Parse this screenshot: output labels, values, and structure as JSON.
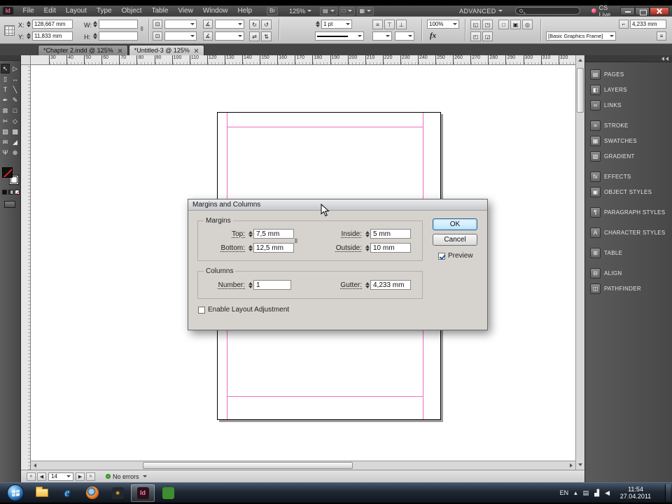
{
  "app_bar": {
    "logo_text": "Id",
    "menus": [
      {
        "name": "menu-file",
        "label": "File"
      },
      {
        "name": "menu-edit",
        "label": "Edit"
      },
      {
        "name": "menu-layout",
        "label": "Layout"
      },
      {
        "name": "menu-type",
        "label": "Type"
      },
      {
        "name": "menu-object",
        "label": "Object"
      },
      {
        "name": "menu-table",
        "label": "Table"
      },
      {
        "name": "menu-view",
        "label": "View"
      },
      {
        "name": "menu-window",
        "label": "Window"
      },
      {
        "name": "menu-help",
        "label": "Help"
      }
    ],
    "bridge_label": "Br",
    "zoom_value": "125%",
    "view_buttons": [
      {
        "name": "view-options-button",
        "glyph": "▤"
      },
      {
        "name": "screen-mode-button",
        "glyph": "□"
      },
      {
        "name": "arrange-documents-button",
        "glyph": "▦"
      }
    ],
    "workspace": "ADVANCED",
    "cs_live_label": "CS Live"
  },
  "control_panel": {
    "x_label": "X:",
    "x_value": "128,667 mm",
    "y_label": "Y:",
    "y_value": "11,833 mm",
    "w_label": "W:",
    "w_value": "",
    "h_label": "H:",
    "h_value": "",
    "chain_glyph": "∞",
    "scale_icon_glyph": "⊡",
    "shear_icon_glyph": "∡",
    "transform_buttons": [
      {
        "name": "rotate-90-cw-button",
        "glyph": "↻"
      },
      {
        "name": "rotate-90-ccw-button",
        "glyph": "↺"
      },
      {
        "name": "flip-horizontal-button",
        "glyph": "⇄"
      },
      {
        "name": "flip-vertical-button",
        "glyph": "⇅"
      }
    ],
    "stroke_weight": "1 pt",
    "stroke_icons": [
      {
        "name": "stroke-align-icon",
        "glyph": "≡"
      },
      {
        "name": "cap-icon",
        "glyph": "⊤"
      },
      {
        "name": "join-icon",
        "glyph": "⊥"
      }
    ],
    "fx_label": "fx",
    "opacity_value": "100%",
    "fitting_buttons": [
      {
        "name": "fill-frame-proportionally-button",
        "glyph": "◱"
      },
      {
        "name": "fit-content-proportionally-button",
        "glyph": "◳"
      },
      {
        "name": "center-content-button",
        "glyph": "◰"
      },
      {
        "name": "fit-frame-to-content-button",
        "glyph": "◲"
      }
    ],
    "wrap_buttons": [
      {
        "name": "no-text-wrap-button",
        "glyph": "□"
      },
      {
        "name": "wrap-around-bounding-box-button",
        "glyph": "▣"
      },
      {
        "name": "wrap-around-object-shape-button",
        "glyph": "◎"
      }
    ],
    "corner_icon_glyph": "⌐",
    "corner_radius": "4,233 mm",
    "object_style": "[Basic Graphics Frame]",
    "panel_menu_glyph": "≡"
  },
  "tabs": [
    {
      "name": "document-tab-chapter2",
      "label": "*Chapter 2.indd @ 125%"
    },
    {
      "name": "document-tab-untitled3",
      "label": "*Untitled-3 @ 125%",
      "active": true
    }
  ],
  "ruler": {
    "numbers": [
      30,
      40,
      50,
      60,
      70,
      80,
      90,
      100,
      110,
      120,
      130,
      140,
      150,
      160,
      170,
      180,
      190,
      200,
      210,
      220,
      230,
      240,
      250,
      260,
      270,
      280,
      290,
      300,
      310,
      320
    ]
  },
  "tools": [
    {
      "name": "selection-tool",
      "glyph": "↖"
    },
    {
      "name": "direct-selection-tool",
      "glyph": "▷"
    },
    {
      "name": "page-tool",
      "glyph": "▯"
    },
    {
      "name": "gap-tool",
      "glyph": "↔"
    },
    {
      "name": "type-tool",
      "glyph": "T"
    },
    {
      "name": "line-tool",
      "glyph": "╲"
    },
    {
      "name": "pen-tool",
      "glyph": "✒"
    },
    {
      "name": "pencil-tool",
      "glyph": "✎"
    },
    {
      "name": "rectangle-frame-tool",
      "glyph": "⊠"
    },
    {
      "name": "rectangle-tool",
      "glyph": "□"
    },
    {
      "name": "scissors-tool",
      "glyph": "✂"
    },
    {
      "name": "free-transform-tool",
      "glyph": "◇"
    },
    {
      "name": "gradient-swatch-tool",
      "glyph": "▨"
    },
    {
      "name": "gradient-feather-tool",
      "glyph": "▩"
    },
    {
      "name": "note-tool",
      "glyph": "✉"
    },
    {
      "name": "eyedropper-tool",
      "glyph": "◢"
    },
    {
      "name": "hand-tool",
      "glyph": "Ψ"
    },
    {
      "name": "zoom-tool",
      "glyph": "⊕"
    }
  ],
  "dialog": {
    "title": "Margins and Columns",
    "margins_label": "Margins",
    "columns_label": "Columns",
    "top_label": "Top:",
    "top_value": "7,5 mm",
    "bottom_label": "Bottom:",
    "bottom_value": "12,5 mm",
    "inside_label": "Inside:",
    "inside_value": "5 mm",
    "outside_label": "Outside:",
    "outside_value": "10 mm",
    "number_label": "Number:",
    "number_value": "1",
    "gutter_label": "Gutter:",
    "gutter_value": "4,233 mm",
    "chain_glyph": "∞",
    "ok_label": "OK",
    "cancel_label": "Cancel",
    "preview_label": "Preview",
    "preview_checked": true,
    "enable_layout_label": "Enable Layout Adjustment",
    "enable_layout_checked": false
  },
  "dock": {
    "panels": [
      {
        "name": "panel-button-pages",
        "label": "PAGES",
        "glyph": "▤"
      },
      {
        "name": "panel-button-layers",
        "label": "LAYERS",
        "glyph": "◧"
      },
      {
        "name": "panel-button-links",
        "label": "LINKS",
        "glyph": "∞"
      },
      {
        "name": "panel-button-stroke",
        "label": "STROKE",
        "glyph": "≡",
        "gap": true
      },
      {
        "name": "panel-button-swatches",
        "label": "SWATCHES",
        "glyph": "▦"
      },
      {
        "name": "panel-button-gradient",
        "label": "GRADIENT",
        "glyph": "▧"
      },
      {
        "name": "panel-button-effects",
        "label": "EFFECTS",
        "glyph": "fx",
        "gap": true
      },
      {
        "name": "panel-button-object-styles",
        "label": "OBJECT STYLES",
        "glyph": "▣"
      },
      {
        "name": "panel-button-paragraph-styles",
        "label": "PARAGRAPH STYLES",
        "glyph": "¶",
        "gap": true
      },
      {
        "name": "panel-button-character-styles",
        "label": "CHARACTER STYLES",
        "glyph": "A",
        "gap": true
      },
      {
        "name": "panel-button-table",
        "label": "TABLE",
        "glyph": "⊞",
        "gap": true
      },
      {
        "name": "panel-button-align",
        "label": "ALIGN",
        "glyph": "⊟",
        "gap": true
      },
      {
        "name": "panel-button-pathfinder",
        "label": "PATHFINDER",
        "glyph": "◫"
      }
    ]
  },
  "status_bar": {
    "nav_left": [
      {
        "name": "first-spread-button",
        "glyph": "«"
      },
      {
        "name": "previous-spread-button",
        "glyph": "◀"
      }
    ],
    "page_value": "14",
    "nav_right": [
      {
        "name": "next-spread-button",
        "glyph": "▶"
      },
      {
        "name": "last-spread-button",
        "glyph": "»"
      }
    ],
    "preflight_label": "No errors",
    "preflight_color": "#4caf2e"
  },
  "taskbar": {
    "apps": [
      {
        "name": "windows-explorer-icon",
        "kind": "folder"
      },
      {
        "name": "internet-explorer-icon",
        "kind": "badge",
        "glyph": "e"
      },
      {
        "name": "firefox-icon",
        "kind": "firefox"
      },
      {
        "name": "flower-app-icon",
        "kind": "badge",
        "glyph": "∗",
        "bg": "#23282f",
        "fg": "#f0a030"
      },
      {
        "name": "indesign-icon",
        "kind": "badge",
        "glyph": "Id",
        "bg": "#2a1018",
        "fg": "#ff7ab8",
        "active": true
      },
      {
        "name": "green-app-icon",
        "kind": "badge",
        "glyph": "",
        "bg": "#3e8e2f",
        "fg": "#ffffff"
      }
    ],
    "tray": [
      {
        "name": "language-indicator",
        "text": "EN"
      },
      {
        "name": "hidden-icons-button",
        "text": "▴"
      },
      {
        "name": "tray-app-icon",
        "text": "▤"
      },
      {
        "name": "network-icon",
        "text": "▟"
      },
      {
        "name": "volume-icon",
        "text": "◀"
      }
    ],
    "clock_time": "11:54",
    "clock_date": "27.04.2011"
  },
  "guide_colors": {
    "margin": "#ef6fc1",
    "page_border": "#000000"
  }
}
